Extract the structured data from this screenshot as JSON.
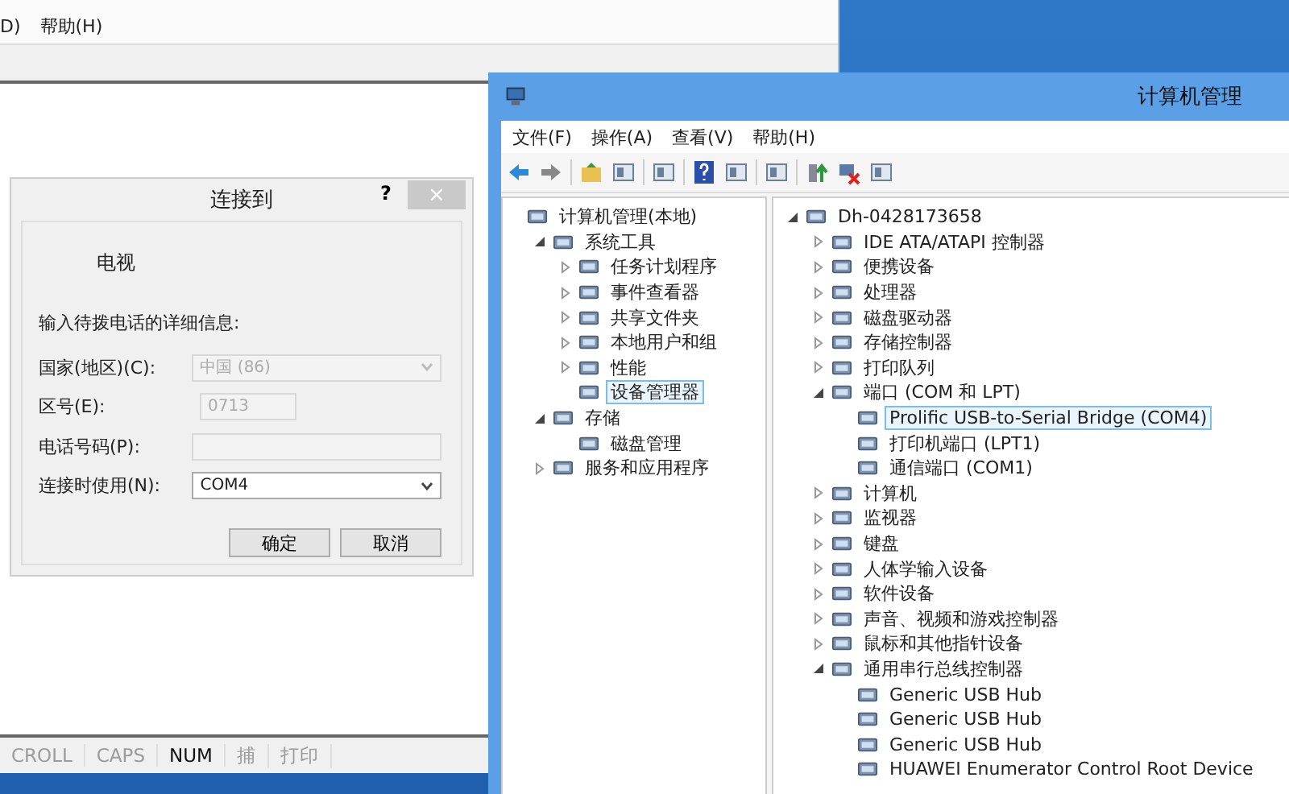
{
  "terminal_window": {
    "menu": [
      "D)",
      "帮助(H)"
    ],
    "status_bar": [
      {
        "label": "CROLL",
        "on": false
      },
      {
        "label": "CAPS",
        "on": false
      },
      {
        "label": "NUM",
        "on": true
      },
      {
        "label": "捕",
        "on": false
      },
      {
        "label": "打印",
        "on": false
      }
    ]
  },
  "dialog": {
    "title": "连接到",
    "help": "?",
    "close": "×",
    "entry_name": "电视",
    "instruction": "输入待拨电话的详细信息:",
    "fields": [
      {
        "label": "国家(地区)(C):",
        "kind": "dropdown",
        "value": "中国 (86)",
        "disabled": true
      },
      {
        "label": "区号(E):",
        "kind": "short_text",
        "value": "0713",
        "disabled": true
      },
      {
        "label": "电话号码(P):",
        "kind": "text",
        "disabled": true
      },
      {
        "label": "连接时使用(N):",
        "kind": "dropdown",
        "value": "COM4",
        "disabled": false
      }
    ],
    "buttons": [
      "确定",
      "取消"
    ]
  },
  "computer_management": {
    "title": "计算机管理",
    "menu": [
      "文件(F)",
      "操作(A)",
      "查看(V)",
      "帮助(H)"
    ],
    "left_tree": [
      {
        "label": "计算机管理(本地)",
        "selected": false,
        "children": [
          {
            "label": "系统工具",
            "expanded": true,
            "selected": false,
            "children": [
              {
                "label": "任务计划程序",
                "expanded": false,
                "selected": false
              },
              {
                "label": "事件查看器",
                "expanded": false,
                "selected": false
              },
              {
                "label": "共享文件夹",
                "expanded": false,
                "selected": false
              },
              {
                "label": "本地用户和组",
                "expanded": false,
                "selected": false
              },
              {
                "label": "性能",
                "expanded": false,
                "selected": false
              },
              {
                "label": "设备管理器",
                "selected": true
              }
            ]
          },
          {
            "label": "存储",
            "expanded": true,
            "selected": false,
            "children": [
              {
                "label": "磁盘管理",
                "selected": false
              }
            ]
          },
          {
            "label": "服务和应用程序",
            "expanded": false,
            "selected": false
          }
        ]
      }
    ],
    "right_tree": [
      {
        "label": "Dh-0428173658",
        "expanded": true,
        "selected": false,
        "children": [
          {
            "label": "IDE ATA/ATAPI 控制器",
            "expanded": false,
            "selected": false
          },
          {
            "label": "便携设备",
            "expanded": false,
            "selected": false
          },
          {
            "label": "处理器",
            "expanded": false,
            "selected": false
          },
          {
            "label": "磁盘驱动器",
            "expanded": false,
            "selected": false
          },
          {
            "label": "存储控制器",
            "expanded": false,
            "selected": false
          },
          {
            "label": "打印队列",
            "expanded": false,
            "selected": false
          },
          {
            "label": "端口 (COM 和 LPT)",
            "expanded": true,
            "selected": false,
            "children": [
              {
                "label": "Prolific USB-to-Serial Bridge (COM4)",
                "selected": true
              },
              {
                "label": "打印机端口 (LPT1)",
                "selected": false
              },
              {
                "label": "通信端口 (COM1)",
                "selected": false
              }
            ]
          },
          {
            "label": "计算机",
            "expanded": false,
            "selected": false
          },
          {
            "label": "监视器",
            "expanded": false,
            "selected": false
          },
          {
            "label": "键盘",
            "expanded": false,
            "selected": false
          },
          {
            "label": "人体学输入设备",
            "expanded": false,
            "selected": false
          },
          {
            "label": "软件设备",
            "expanded": false,
            "selected": false
          },
          {
            "label": "声音、视频和游戏控制器",
            "expanded": false,
            "selected": false
          },
          {
            "label": "鼠标和其他指针设备",
            "expanded": false,
            "selected": false
          },
          {
            "label": "通用串行总线控制器",
            "expanded": true,
            "selected": false,
            "children": [
              {
                "label": "Generic USB Hub",
                "selected": false
              },
              {
                "label": "Generic USB Hub",
                "selected": false
              },
              {
                "label": "Generic USB Hub",
                "selected": false
              },
              {
                "label": "HUAWEI Enumerator Control Root Device",
                "selected": false
              }
            ]
          }
        ]
      }
    ]
  }
}
